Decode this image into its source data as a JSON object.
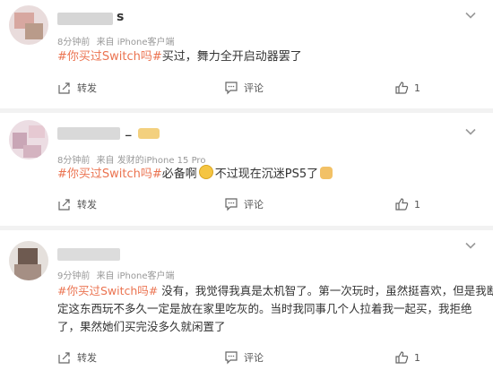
{
  "posts": [
    {
      "username": "s",
      "meta": [
        "8分钟前",
        "来自 iPhone客户端"
      ],
      "tag": "#你买过Switch吗#",
      "text": "买过，舞力全开启动器罢了",
      "share_label": "转发",
      "comment_label": "评论",
      "like_count": "1"
    },
    {
      "username": "_",
      "meta": [
        "8分钟前",
        "来自 发财的iPhone 15 Pro"
      ],
      "tag": "#你买过Switch吗#",
      "text_a": "必备啊",
      "text_b": "不过现在沉迷PS5了",
      "share_label": "转发",
      "comment_label": "评论",
      "like_count": "1"
    },
    {
      "username": "",
      "meta": [
        "9分钟前",
        "来自 iPhone客户端"
      ],
      "tag": "#你买过Switch吗#",
      "lines": [
        " 没有，我觉得我真是太机智了。第一次玩时，虽然挺喜欢，但是我断",
        "定这东西玩不多久一定是放在家里吃灰的。当时我同事几个人拉着我一起买，我拒绝",
        "了，果然她们买完没多久就闲置了"
      ],
      "share_label": "转发",
      "comment_label": "评论",
      "like_count": "1"
    }
  ],
  "colors": {
    "tag": "#eb7350",
    "meta": "#999999",
    "text": "#333333"
  },
  "icons": [
    "chevron-down-icon",
    "share-icon",
    "comment-icon",
    "like-icon",
    "smile-emoji-icon",
    "cat-emoji-icon"
  ]
}
